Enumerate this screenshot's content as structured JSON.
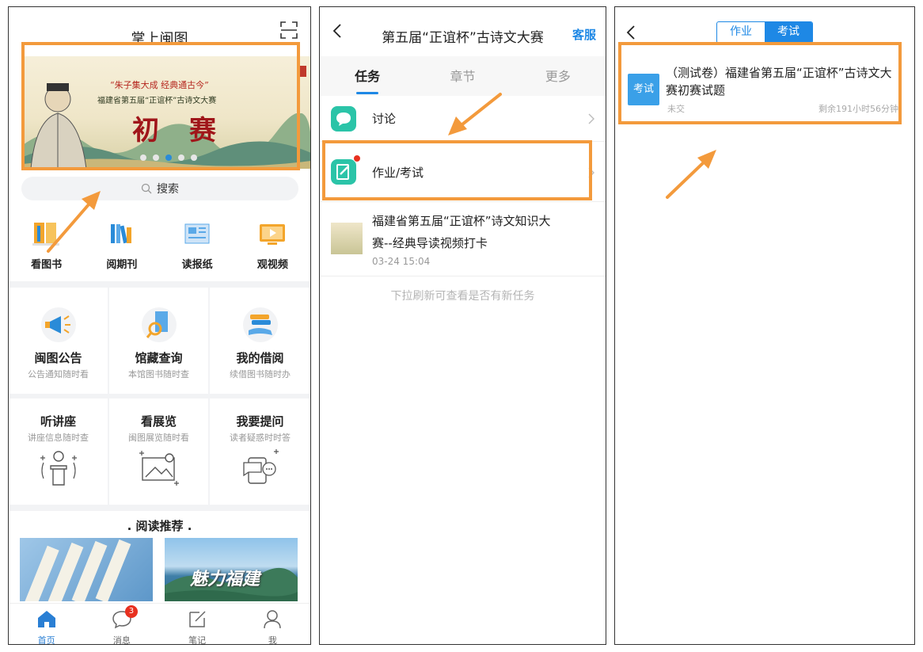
{
  "panel1": {
    "title": "掌上闽图",
    "banner": {
      "slogan": "“朱子集大成 经典通古今”",
      "subtitle": "福建省第五届“正谊杯”古诗文大赛",
      "main": "初赛"
    },
    "search_label": "搜索",
    "quick_items": [
      {
        "label": "看图书",
        "icon": "book-icon"
      },
      {
        "label": "阅期刊",
        "icon": "magazine-icon"
      },
      {
        "label": "读报纸",
        "icon": "newspaper-icon"
      },
      {
        "label": "观视频",
        "icon": "video-icon"
      }
    ],
    "services": [
      {
        "title": "闽图公告",
        "subtitle": "公告通知随时看",
        "icon": "megaphone-icon"
      },
      {
        "title": "馆藏查询",
        "subtitle": "本馆图书随时查",
        "icon": "search-book-icon"
      },
      {
        "title": "我的借阅",
        "subtitle": "续借图书随时办",
        "icon": "borrow-icon"
      },
      {
        "title": "听讲座",
        "subtitle": "讲座信息随时查",
        "icon": "lecture-icon"
      },
      {
        "title": "看展览",
        "subtitle": "闽图展览随时看",
        "icon": "gallery-icon"
      },
      {
        "title": "我要提问",
        "subtitle": "读者疑惑时时答",
        "icon": "question-icon"
      }
    ],
    "recommend_title": ". 阅读推荐 .",
    "recommend_image_text": "魅力福建",
    "tabbar": [
      {
        "label": "首页",
        "icon": "home-icon",
        "active": true
      },
      {
        "label": "消息",
        "icon": "message-icon",
        "badge": "3"
      },
      {
        "label": "笔记",
        "icon": "note-icon"
      },
      {
        "label": "我",
        "icon": "user-icon"
      }
    ]
  },
  "panel2": {
    "title": "第五届“正谊杯”古诗文大赛",
    "right_action": "客服",
    "tabs": [
      {
        "label": "任务",
        "active": true
      },
      {
        "label": "章节"
      },
      {
        "label": "更多"
      }
    ],
    "rows": [
      {
        "label": "讨论",
        "icon": "discussion-icon"
      },
      {
        "label": "作业/考试",
        "icon": "homework-icon"
      }
    ],
    "task": {
      "line1": "福建省第五届“正谊杯”诗文知识大",
      "line2": "赛--经典导读视频打卡",
      "date": "03-24 15:04"
    },
    "pull_hint": "下拉刷新可查看是否有新任务"
  },
  "panel3": {
    "segments": [
      {
        "label": "作业"
      },
      {
        "label": "考试",
        "active": true
      }
    ],
    "exam": {
      "tag": "考试",
      "title": "（测试卷）福建省第五届“正谊杯”古诗文大赛初赛试题",
      "status": "未交",
      "remaining": "剩余191小时56分钟"
    }
  },
  "colors": {
    "accent_blue": "#1e88e5",
    "highlight_orange": "#f39a3c",
    "badge_red": "#e8301f",
    "teal_icon": "#2bc4a8"
  }
}
